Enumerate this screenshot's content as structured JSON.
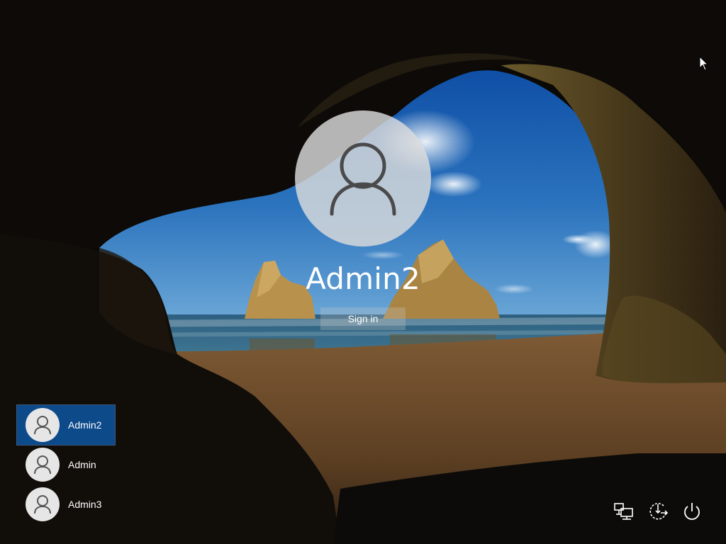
{
  "lock_screen": {
    "selected_user": "Admin2",
    "sign_in_label": "Sign in"
  },
  "users": [
    {
      "name": "Admin2",
      "selected": true
    },
    {
      "name": "Admin",
      "selected": false
    },
    {
      "name": "Admin3",
      "selected": false
    }
  ],
  "system_icons": [
    "network-icon",
    "ease-of-access-icon",
    "power-icon"
  ],
  "colors": {
    "selected_user_background": "#0c4a8a",
    "text": "#ffffff"
  }
}
